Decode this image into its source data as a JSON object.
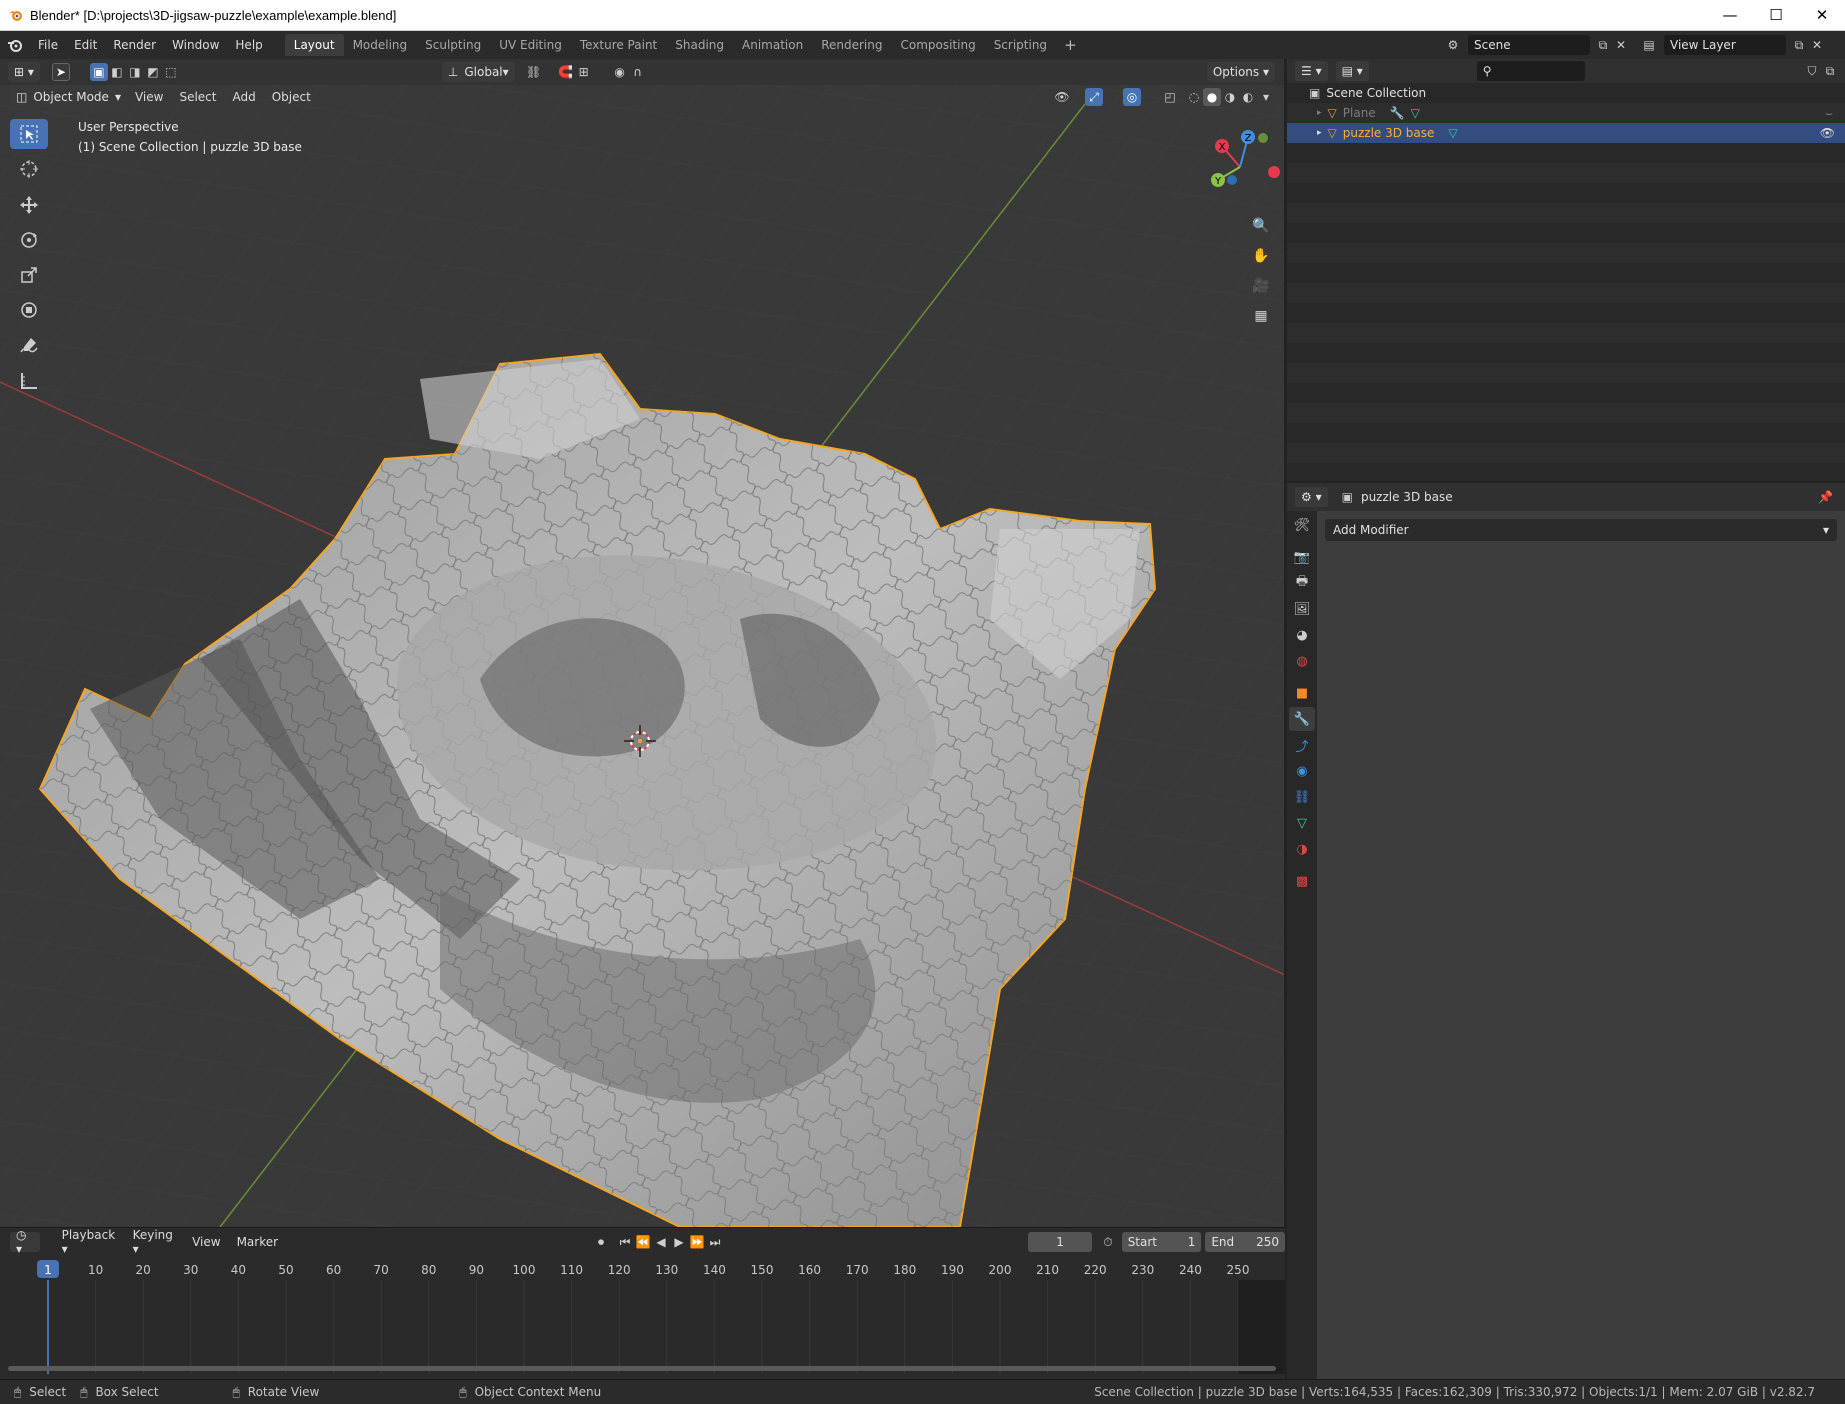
{
  "window": {
    "title": "Blender* [D:\\projects\\3D-jigsaw-puzzle\\example\\example.blend]",
    "minimize": "—",
    "maximize": "☐",
    "close": "✕"
  },
  "menu": [
    "File",
    "Edit",
    "Render",
    "Window",
    "Help"
  ],
  "workspaces": [
    "Layout",
    "Modeling",
    "Sculpting",
    "UV Editing",
    "Texture Paint",
    "Shading",
    "Animation",
    "Rendering",
    "Compositing",
    "Scripting"
  ],
  "active_workspace": "Layout",
  "scene": {
    "name": "Scene",
    "view_layer": "View Layer"
  },
  "viewport": {
    "mode": "Object Mode",
    "menus": [
      "View",
      "Select",
      "Add",
      "Object"
    ],
    "transform_orientation": "Global",
    "options_label": "Options",
    "view_name": "User Perspective",
    "collection_info": "(1) Scene Collection | puzzle 3D base",
    "gizmo_axes": {
      "x": "X",
      "y": "Y",
      "z": "Z"
    }
  },
  "timeline": {
    "menus": [
      "Playback",
      "Keying",
      "View",
      "Marker"
    ],
    "current_frame": "1",
    "start_label": "Start",
    "start": "1",
    "end_label": "End",
    "end": "250",
    "ruler_labels": [
      "1",
      "10",
      "20",
      "30",
      "40",
      "50",
      "60",
      "70",
      "80",
      "90",
      "100",
      "110",
      "120",
      "130",
      "140",
      "150",
      "160",
      "170",
      "180",
      "190",
      "200",
      "210",
      "220",
      "230",
      "240",
      "250"
    ]
  },
  "outliner": {
    "root": "Scene Collection",
    "items": [
      {
        "name": "Plane",
        "selected": false,
        "hidden": true
      },
      {
        "name": "puzzle 3D base",
        "selected": true,
        "hidden": false
      }
    ]
  },
  "properties": {
    "object_name": "puzzle 3D base",
    "add_modifier": "Add Modifier"
  },
  "statusbar": {
    "select": "Select",
    "box_select": "Box Select",
    "rotate_view": "Rotate View",
    "context_menu": "Object Context Menu",
    "stats": "Scene Collection | puzzle 3D base | Verts:164,535 | Faces:162,309 | Tris:330,972 | Objects:1/1 | Mem: 2.07 GiB | v2.82.7"
  },
  "colors": {
    "accent": "#4772b3",
    "selection_outline": "#f5a623",
    "axis_x": "#e8384f",
    "axis_y": "#8ac24a",
    "axis_z": "#3d8fe0"
  }
}
